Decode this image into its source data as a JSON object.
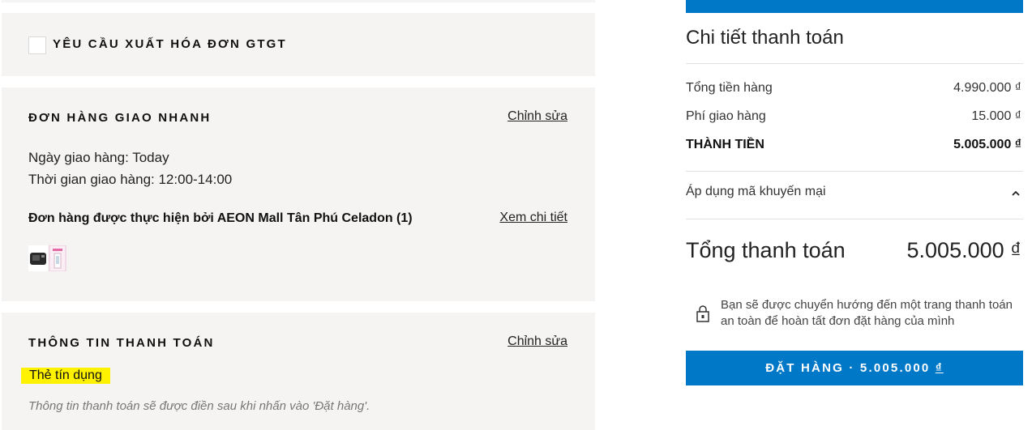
{
  "invoice": {
    "label": "YÊU CẦU XUẤT HÓA ĐƠN GTGT"
  },
  "delivery": {
    "title": "ĐƠN HÀNG GIAO NHANH",
    "edit_label": "Chỉnh sửa",
    "date_line": "Ngày giao hàng: Today",
    "time_line": "Thời gian giao hàng: 12:00-14:00",
    "fulfilled_by": "Đơn hàng được thực hiện bởi AEON Mall Tân Phú Celadon (1)",
    "view_detail_label": "Xem chi tiết"
  },
  "payment": {
    "title": "THÔNG TIN THANH TOÁN",
    "edit_label": "Chỉnh sửa",
    "method": "Thẻ tín dụng",
    "note": "Thông tin thanh toán sẽ được điền sau khi nhấn vào 'Đặt hàng'."
  },
  "summary": {
    "title": "Chi tiết thanh toán",
    "rows": [
      {
        "label": "Tổng tiền hàng",
        "value": "4.990.000 ₫"
      },
      {
        "label": "Phí giao hàng",
        "value": "15.000 ₫"
      },
      {
        "label": "THÀNH TIỀN",
        "value": "5.005.000 ₫"
      }
    ],
    "promo_label": "Áp dụng mã khuyến mại",
    "total_label": "Tổng thanh toán",
    "total_value": "5.005.000 ₫",
    "redirect_text": "Bạn sẽ được chuyển hướng đến một trang thanh toán an toàn để hoàn tất đơn đặt hàng của mình",
    "order_button_prefix": "ĐẶT HÀNG · 5.005.000",
    "order_button_currency": "₫"
  },
  "colors": {
    "accent": "#0078c8",
    "highlight": "#fff200",
    "panel_bg": "#f5f4f2"
  },
  "icons": [
    "checkbox-icon",
    "chevron-up-icon",
    "lock-icon"
  ]
}
